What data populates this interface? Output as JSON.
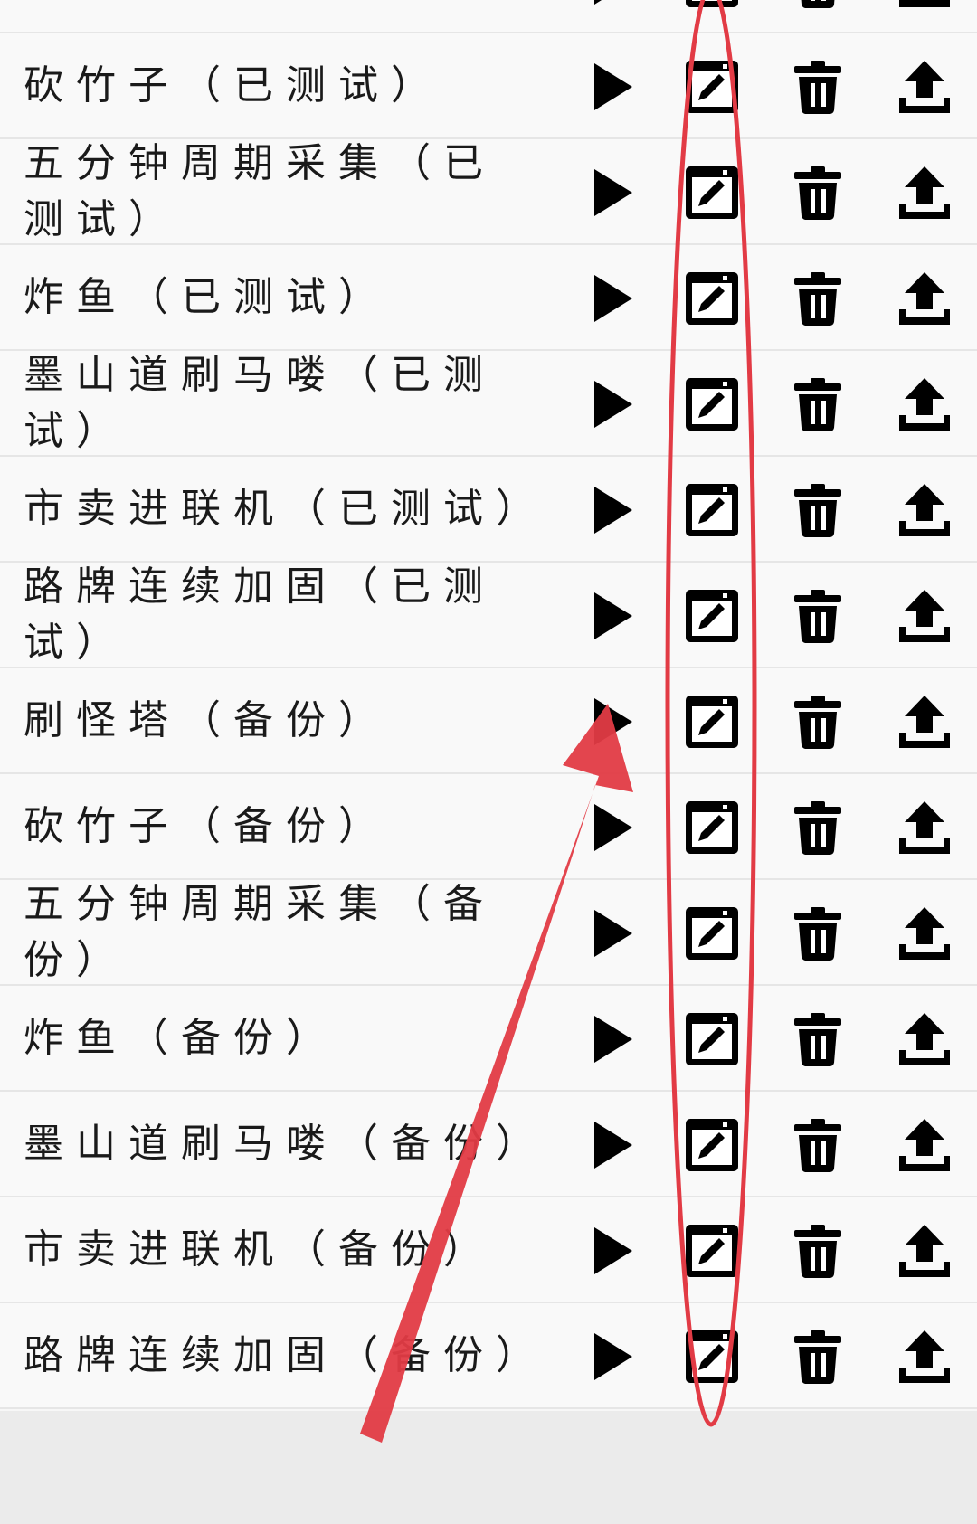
{
  "rows": [
    {
      "title": ""
    },
    {
      "title": "砍竹子（已测试）"
    },
    {
      "title": "五分钟周期采集（已测试）"
    },
    {
      "title": "炸鱼（已测试）"
    },
    {
      "title": "墨山道刷马喽（已测试）"
    },
    {
      "title": "市卖进联机（已测试）"
    },
    {
      "title": "路牌连续加固（已测试）"
    },
    {
      "title": "刷怪塔（备份）"
    },
    {
      "title": "砍竹子（备份）"
    },
    {
      "title": "五分钟周期采集（备份）"
    },
    {
      "title": "炸鱼（备份）"
    },
    {
      "title": "墨山道刷马喽（备份）"
    },
    {
      "title": "市卖进联机（备份）"
    },
    {
      "title": "路牌连续加固（备份）"
    }
  ],
  "icons": {
    "play": "play-icon",
    "edit": "edit-icon",
    "delete": "trash-icon",
    "upload": "upload-icon"
  },
  "colors": {
    "annotation": "#e23b45",
    "icon": "#000000",
    "background": "#f7f7f7"
  }
}
